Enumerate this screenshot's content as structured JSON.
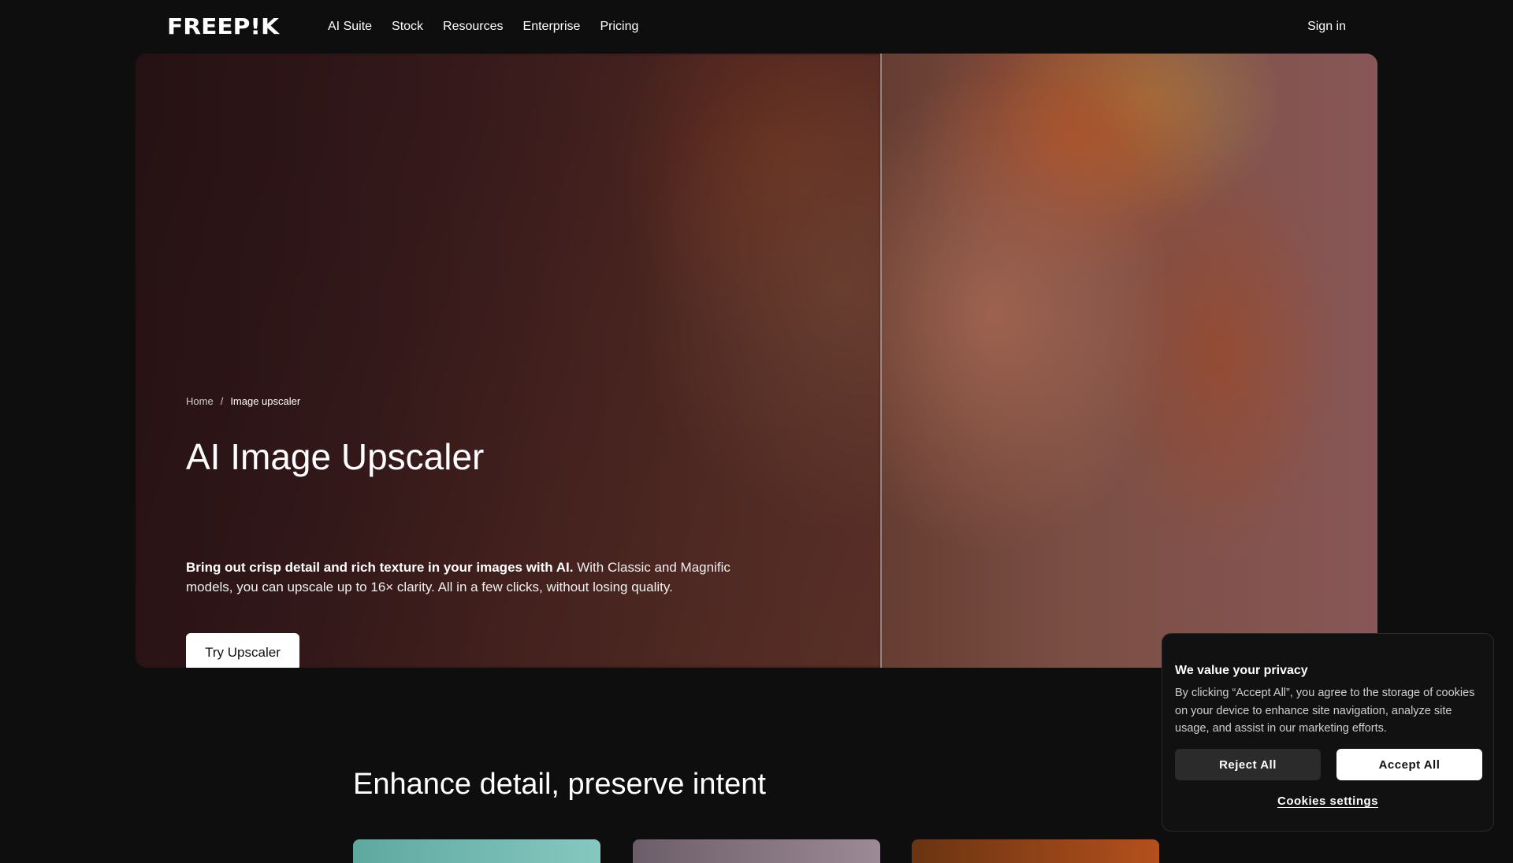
{
  "nav": {
    "logo": "FREEP!K",
    "links": [
      "AI Suite",
      "Stock",
      "Resources",
      "Enterprise",
      "Pricing"
    ],
    "sign_in": "Sign in"
  },
  "hero": {
    "breadcrumb": {
      "home": "Home",
      "separator": "/",
      "current": "Image upscaler"
    },
    "title": "AI Image Upscaler",
    "desc_bold": "Bring out crisp detail and rich texture in your images with AI.",
    "desc_rest": " With Classic and Magnific models, you can upscale up to 16× clarity. All in a few clicks, without losing quality.",
    "cta": "Try Upscaler"
  },
  "section": {
    "title": "Enhance detail, preserve intent"
  },
  "cookie": {
    "title": "We value your privacy",
    "text": "By clicking “Accept All”, you agree to the storage of cookies on your device to enhance site navigation, analyze site usage, and assist in our marketing efforts.",
    "reject": "Reject All",
    "accept": "Accept All",
    "settings": "Cookies settings"
  },
  "colors": {
    "background": "#0e0e0e",
    "hero_tint": "#3b1c1c",
    "button_light": "#ffffff",
    "button_dark": "#2b2b2b"
  }
}
